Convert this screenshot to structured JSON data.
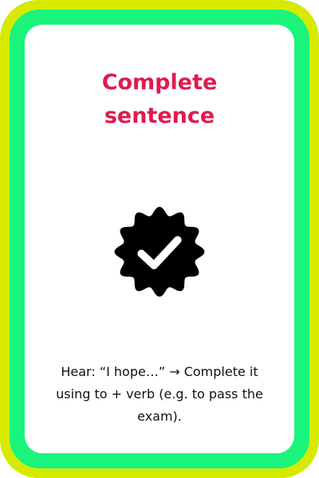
{
  "card": {
    "title_line1": "Complete",
    "title_line2": "sentence",
    "icon": "verified-check-badge-icon",
    "description": "Hear: “I hope…” → Complete it using to + verb (e.g. to pass the exam)."
  },
  "colors": {
    "outer_border": "#d6ea00",
    "inner_border": "#19f47d",
    "title": "#e01a4f",
    "icon": "#000000"
  }
}
